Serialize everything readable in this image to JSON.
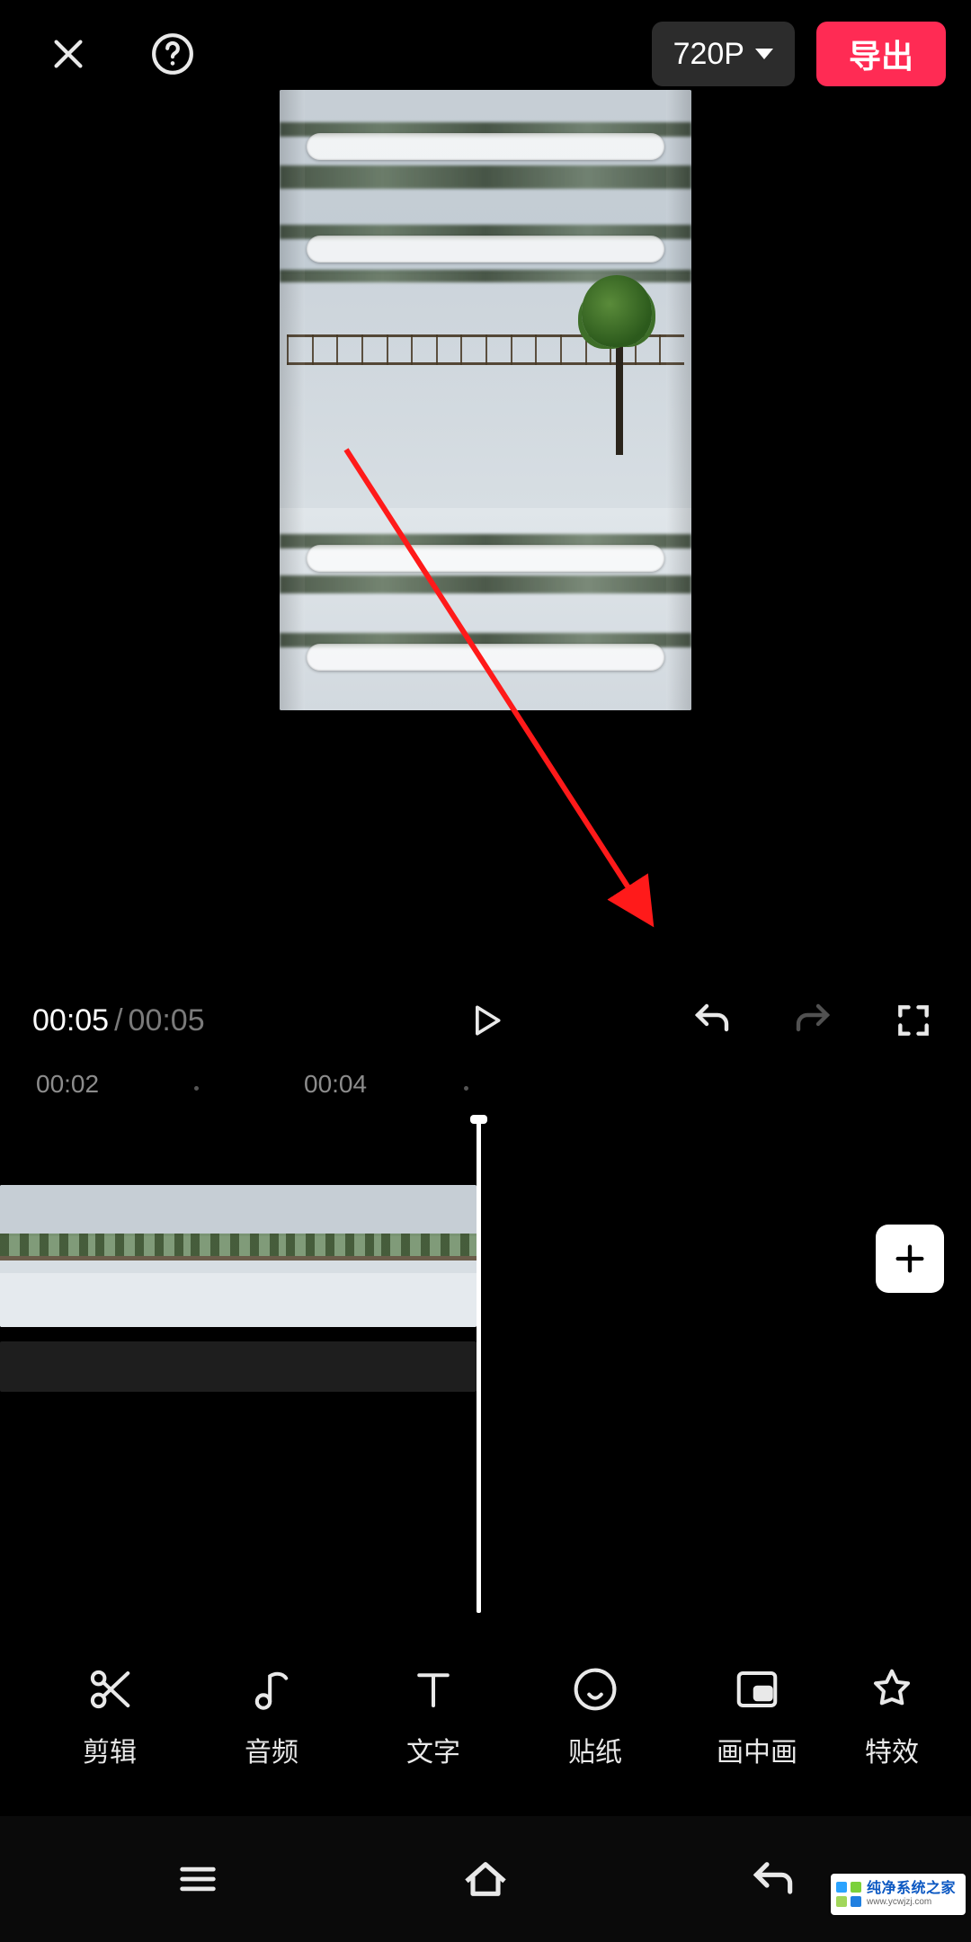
{
  "header": {
    "resolution_label": "720P",
    "export_label": "导出"
  },
  "playback": {
    "current": "00:05",
    "separator": "/",
    "total": "00:05"
  },
  "ruler": {
    "ticks": [
      "00:02",
      "00:04"
    ]
  },
  "tools": [
    {
      "id": "edit",
      "label": "剪辑",
      "icon": "scissors-icon"
    },
    {
      "id": "audio",
      "label": "音频",
      "icon": "music-note-icon"
    },
    {
      "id": "text",
      "label": "文字",
      "icon": "text-icon"
    },
    {
      "id": "sticker",
      "label": "贴纸",
      "icon": "sticker-icon"
    },
    {
      "id": "pip",
      "label": "画中画",
      "icon": "pip-icon"
    },
    {
      "id": "effects",
      "label": "特效",
      "icon": "star-icon"
    }
  ],
  "watermark": {
    "line1": "纯净系统之家",
    "line2": "www.ycwjzj.com"
  },
  "colors": {
    "accent": "#ff2b54",
    "text_muted": "#7a7a7a"
  },
  "icons": {
    "close": "close-icon",
    "help": "help-circle-icon",
    "play": "play-icon",
    "undo": "undo-icon",
    "redo": "redo-icon",
    "fullscreen": "fullscreen-icon",
    "add": "plus-icon",
    "nav_menu": "menu-icon",
    "nav_home": "home-icon",
    "nav_back": "back-icon"
  },
  "annotation": {
    "arrow_target": "add-clip-button"
  }
}
